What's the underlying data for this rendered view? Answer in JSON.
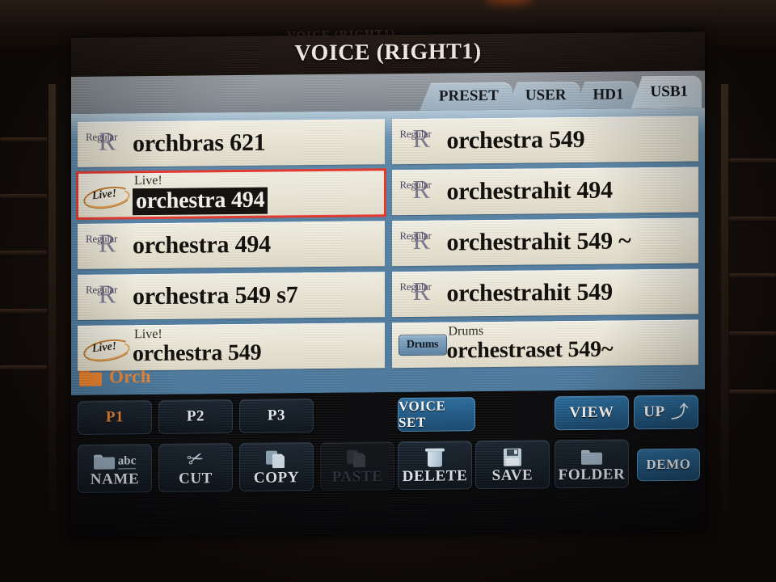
{
  "device": {
    "screen_title": "VOICE (RIGHT1)",
    "reflection_text": "VOICE (RIGHT1)"
  },
  "colors": {
    "panel_blue": "#5a86a8",
    "row_cream": "#efebdc",
    "selection_red": "#e8382e",
    "accent_orange": "#f08a36",
    "lit_button_blue": "#215a86"
  },
  "tabs": [
    {
      "label": "PRESET",
      "active": false
    },
    {
      "label": "USER",
      "active": false
    },
    {
      "label": "HD1",
      "active": false
    },
    {
      "label": "USB1",
      "active": true
    }
  ],
  "voice_list": {
    "left_column": [
      {
        "category": "",
        "name": "orchbras 621",
        "badge": "regular-badge",
        "selected": false
      },
      {
        "category": "Live!",
        "name": "orchestra 494",
        "badge": "live-badge",
        "selected": true
      },
      {
        "category": "",
        "name": "orchestra 494",
        "badge": "regular-badge",
        "selected": false
      },
      {
        "category": "",
        "name": "orchestra 549 s7",
        "badge": "regular-badge",
        "selected": false
      },
      {
        "category": "Live!",
        "name": "orchestra 549",
        "badge": "live-badge",
        "selected": false
      }
    ],
    "right_column": [
      {
        "category": "",
        "name": "orchestra 549",
        "badge": "regular-badge",
        "selected": false
      },
      {
        "category": "",
        "name": "orchestrahit 494",
        "badge": "regular-badge",
        "selected": false
      },
      {
        "category": "",
        "name": "orchestrahit 549 ~",
        "badge": "regular-badge",
        "selected": false
      },
      {
        "category": "",
        "name": "orchestrahit 549",
        "badge": "regular-badge",
        "selected": false
      },
      {
        "category": "Drums",
        "name": "orchestraset 549~",
        "badge": "drums-badge",
        "selected": false
      }
    ],
    "badge_text": {
      "regular": "Regular",
      "regular_glyph": "R",
      "live": "Live!",
      "drums": "Drums"
    }
  },
  "current_folder": {
    "name": "Orch",
    "icon": "folder-icon"
  },
  "page_buttons": [
    {
      "label": "P1",
      "state": "orange"
    },
    {
      "label": "P2",
      "state": "normal"
    },
    {
      "label": "P3",
      "state": "normal"
    }
  ],
  "top_buttons": [
    {
      "label": "VOICE SET",
      "state": "lit"
    },
    {
      "label": "VIEW",
      "state": "lit"
    },
    {
      "label": "UP",
      "state": "lit",
      "icon": "arrow-up-icon"
    }
  ],
  "bottom_buttons": [
    {
      "label": "NAME",
      "state": "normal",
      "icon": "folder-abc-icon"
    },
    {
      "label": "CUT",
      "state": "normal",
      "icon": "scissors-icon"
    },
    {
      "label": "COPY",
      "state": "normal",
      "icon": "copy-pages-icon"
    },
    {
      "label": "PASTE",
      "state": "disabled",
      "icon": "paste-icon"
    },
    {
      "label": "DELETE",
      "state": "normal",
      "icon": "trash-icon"
    },
    {
      "label": "SAVE",
      "state": "normal",
      "icon": "floppy-disk-icon"
    },
    {
      "label": "FOLDER",
      "state": "normal",
      "icon": "folder-icon"
    },
    {
      "label": "DEMO",
      "state": "lit"
    }
  ]
}
